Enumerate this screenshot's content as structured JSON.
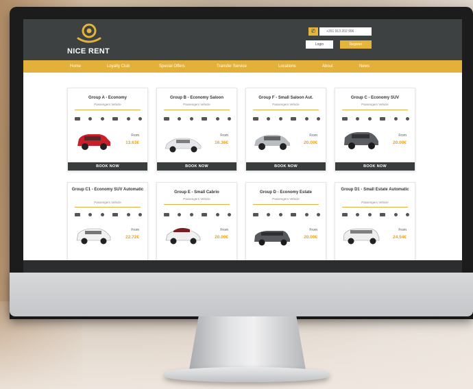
{
  "brand": {
    "name": "NICE RENT"
  },
  "header": {
    "phone": "+351 913 202 996",
    "login_label": "Login",
    "register_label": "Register"
  },
  "nav": {
    "items": [
      "Home",
      "Loyalty Club",
      "Special Offers",
      "Transfer Service",
      "Locations",
      "About",
      "News"
    ]
  },
  "colors": {
    "accent": "#e3b139",
    "header_bg": "#3e4142",
    "price": "#e5a21c",
    "button_bg": "#3a3d3e"
  },
  "cards": [
    {
      "title": "Group A - Economy",
      "subtitle": "Passengers Vehicle",
      "from": "From",
      "price": "13.63€",
      "button": "BOOK NOW",
      "car_color": "#c8202a"
    },
    {
      "title": "Group B - Economy Saloon",
      "subtitle": "Passengers Vehicle",
      "from": "From",
      "price": "16.36€",
      "button": "BOOK NOW",
      "car_color": "#e9eaec"
    },
    {
      "title": "Group F - Small Saloon Aut.",
      "subtitle": "Passengers Vehicle",
      "from": "From",
      "price": "20.00€",
      "button": "BOOK NOW",
      "car_color": "#b9bcc0"
    },
    {
      "title": "Group C - Economy SUV",
      "subtitle": "Passengers Vehicle",
      "from": "From",
      "price": "20.00€",
      "button": "BOOK NOW",
      "car_color": "#5a5d61"
    },
    {
      "title": "Group C1 - Economy SUV Automatic",
      "subtitle": "Passengers Vehicle",
      "from": "From",
      "price": "22.72€",
      "button": "",
      "car_color": "#f2f2f2"
    },
    {
      "title": "Group E - Small Cabrio",
      "subtitle": "Passengers Vehicle",
      "from": "From",
      "price": "20.00€",
      "button": "",
      "car_color": "#f0f0f0"
    },
    {
      "title": "Group D - Economy Estate",
      "subtitle": "Passengers Vehicle",
      "from": "From",
      "price": "20.00€",
      "button": "",
      "car_color": "#55595e"
    },
    {
      "title": "Group D1 - Small Estate Automatic",
      "subtitle": "Passengers Vehicle",
      "from": "From",
      "price": "24.54€",
      "button": "",
      "car_color": "#eeeeee"
    }
  ]
}
